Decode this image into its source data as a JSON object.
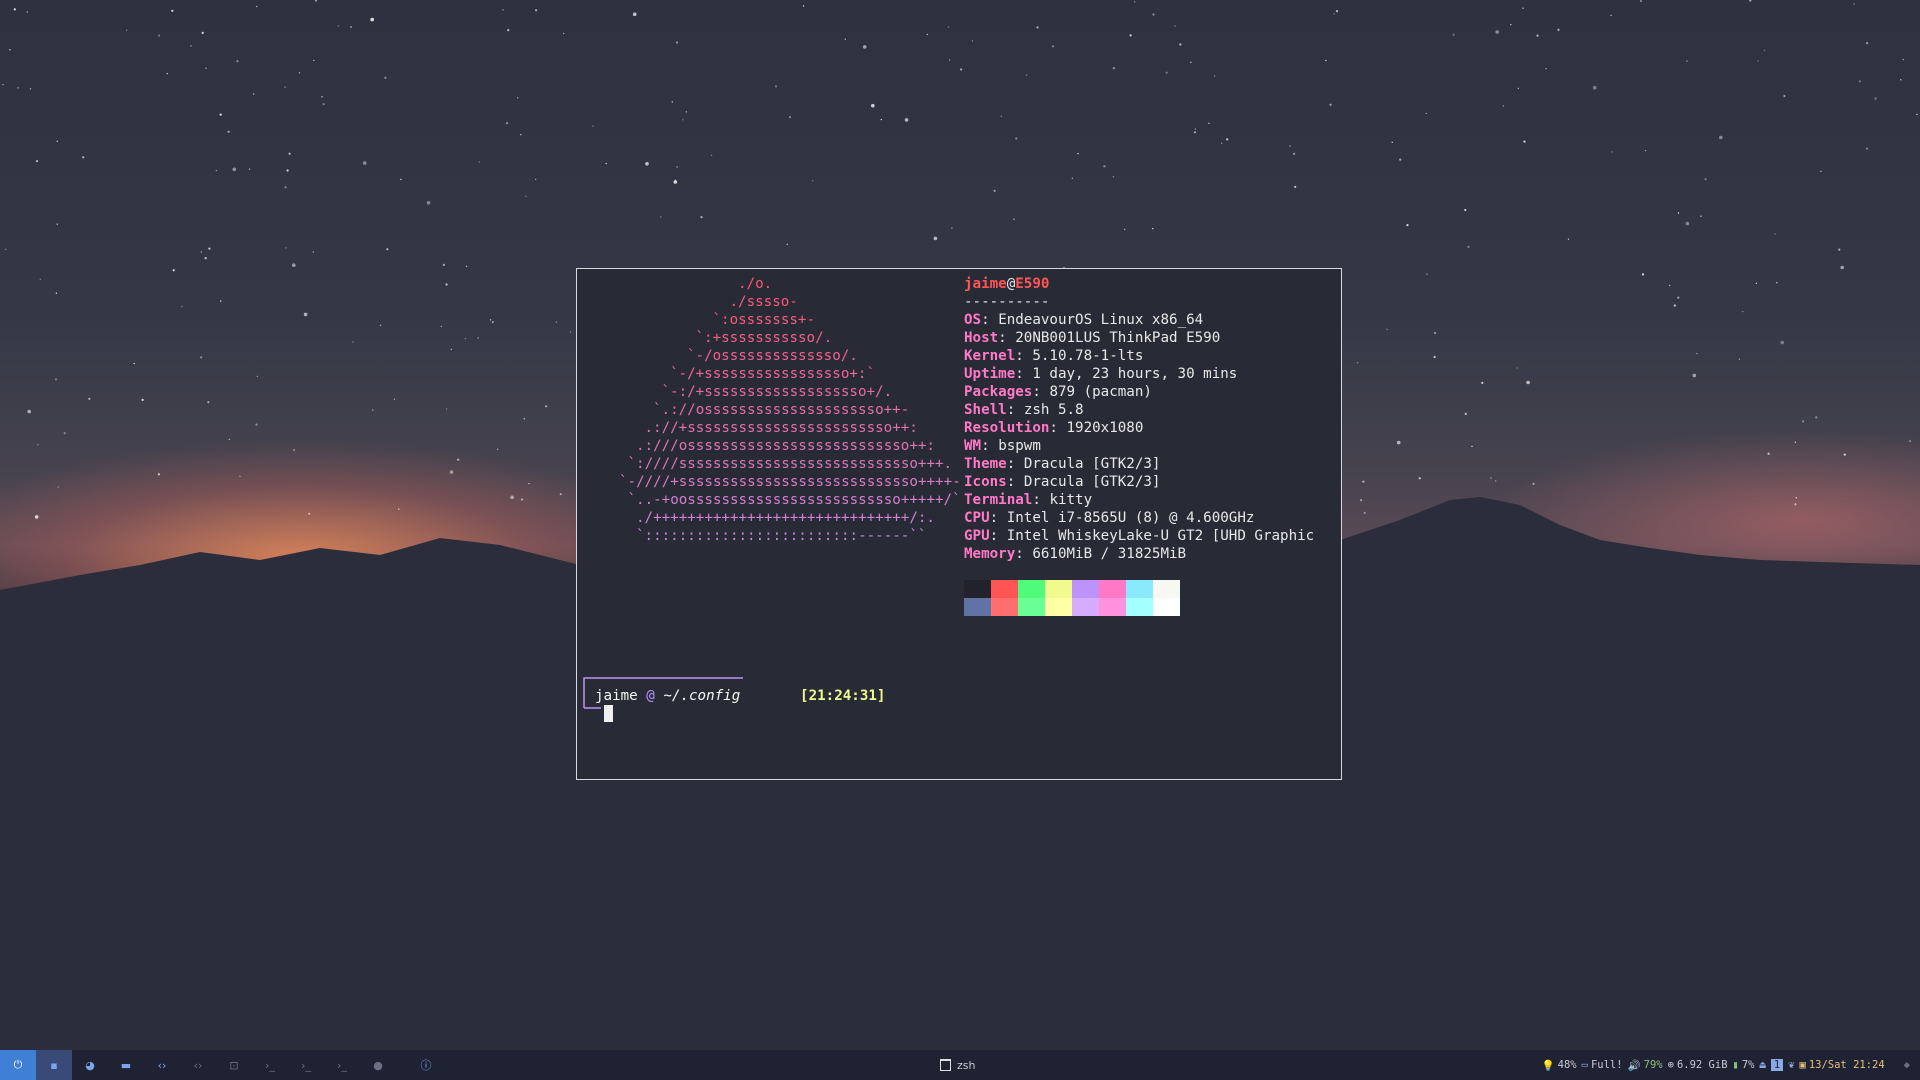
{
  "terminal": {
    "ascii_logo": [
      "./o.",
      "./sssso-",
      "`:osssssss+-",
      "`:+sssssssssso/.",
      "`-/ossssssssssssso/.",
      "`-/+sssssssssssssssso+:`",
      "`-:/+sssssssssssssssssso+/.",
      "`.://osssssssssssssssssssso++-",
      ".://+ssssssssssssssssssssssso++:",
      ".:///ossssssssssssssssssssssssso++:",
      "`:////ssssssssssssssssssssssssssso+++.",
      "`-////+ssssssssssssssssssssssssssso++++-",
      "`..-+oosssssssssssssssssssssssso+++++/`",
      "./++++++++++++++++++++++++++++++/:.",
      "`:::::::::::::::::::::::::------``"
    ],
    "info": {
      "user": "jaime",
      "at": "@",
      "host": "E590",
      "divider": "----------",
      "rows": [
        {
          "key": "OS",
          "value": "EndeavourOS Linux x86_64"
        },
        {
          "key": "Host",
          "value": "20NB001LUS ThinkPad E590"
        },
        {
          "key": "Kernel",
          "value": "5.10.78-1-lts"
        },
        {
          "key": "Uptime",
          "value": "1 day, 23 hours, 30 mins"
        },
        {
          "key": "Packages",
          "value": "879 (pacman)"
        },
        {
          "key": "Shell",
          "value": "zsh 5.8"
        },
        {
          "key": "Resolution",
          "value": "1920x1080"
        },
        {
          "key": "WM",
          "value": "bspwm"
        },
        {
          "key": "Theme",
          "value": "Dracula [GTK2/3]"
        },
        {
          "key": "Icons",
          "value": "Dracula [GTK2/3]"
        },
        {
          "key": "Terminal",
          "value": "kitty"
        },
        {
          "key": "CPU",
          "value": "Intel i7-8565U (8) @ 4.600GHz"
        },
        {
          "key": "GPU",
          "value": "Intel WhiskeyLake-U GT2 [UHD Graphic"
        },
        {
          "key": "Memory",
          "value": "6610MiB / 31825MiB"
        }
      ],
      "palette_top": [
        "#21222c",
        "#ff5555",
        "#50fa7b",
        "#f1fa8c",
        "#bd93f9",
        "#ff79c6",
        "#8be9fd",
        "#f8f8f2"
      ],
      "palette_bottom": [
        "#6272a4",
        "#ff6e6e",
        "#69ff94",
        "#ffffa5",
        "#d6acff",
        "#ff92df",
        "#a4ffff",
        "#ffffff"
      ]
    },
    "prompt": {
      "user": "jaime",
      "at": "@",
      "path": "~/.config",
      "time": "[21:24:31]"
    }
  },
  "taskbar": {
    "left_icons": [
      "power-icon",
      "terminal-icon",
      "firefox-icon",
      "folder-icon",
      "code-icon",
      "code-alt-icon",
      "screenshot-icon",
      "shell-icon",
      "shell-alt-icon",
      "shell-alt2-icon",
      "settings-icon",
      "info-icon"
    ],
    "window_title": "zsh",
    "status": {
      "brightness": "48%",
      "battery": "Full!",
      "volume": "79%",
      "memory": "6.92 GiB",
      "cpu": "7%",
      "workspace": "1",
      "date": "13/Sat 21:24"
    },
    "colors": {
      "accent": "#3f7fd6",
      "volume": "#8ec07c",
      "date": "#e5c07b"
    }
  }
}
